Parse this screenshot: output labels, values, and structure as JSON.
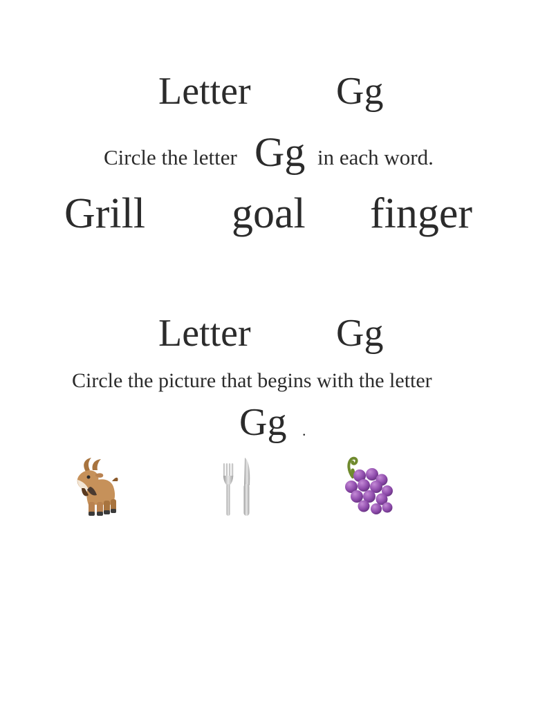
{
  "section1": {
    "title_word": "Letter",
    "title_letter": "Gg",
    "instruction_before": "Circle the letter",
    "instruction_letter": "Gg",
    "instruction_after": "in each word.",
    "words": [
      "Grill",
      "goal",
      "finger"
    ]
  },
  "section2": {
    "title_word": "Letter",
    "title_letter": "Gg",
    "instruction": "Circle the picture that begins with the letter",
    "instruction_letter": "Gg",
    "instruction_end": ".",
    "pictures": [
      {
        "icon": "goat-icon"
      },
      {
        "icon": "fork-and-knife-icon"
      },
      {
        "icon": "grapes-icon"
      }
    ]
  }
}
